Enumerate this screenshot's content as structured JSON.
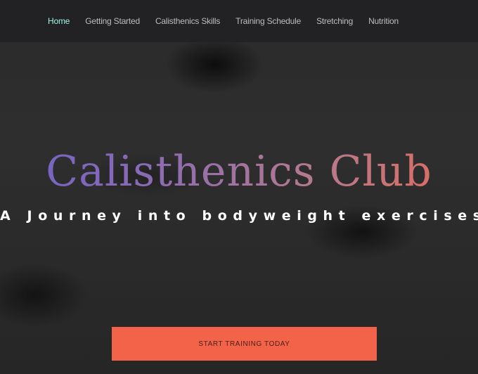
{
  "nav": {
    "items": [
      {
        "label": "Home",
        "active": true
      },
      {
        "label": "Getting Started",
        "active": false
      },
      {
        "label": "Calisthenics Skills",
        "active": false
      },
      {
        "label": "Training Schedule",
        "active": false
      },
      {
        "label": "Stretching",
        "active": false
      },
      {
        "label": "Nutrition",
        "active": false
      }
    ]
  },
  "hero": {
    "title": "Calisthenics Club",
    "subtitle": "A Journey into bodyweight exercises",
    "cta_label": "START TRAINING TODAY"
  },
  "colors": {
    "nav_background": "#222225",
    "nav_active": "#9ef2e4",
    "title_gradient_start": "#6f63c8",
    "title_gradient_end": "#e56a55",
    "cta_background": "#f2634a"
  }
}
